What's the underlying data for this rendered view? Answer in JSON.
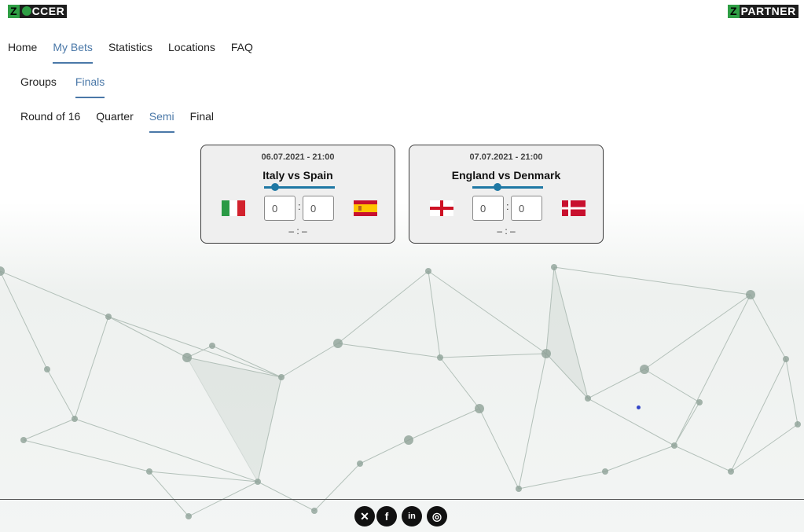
{
  "logos": {
    "left": {
      "z": "Z",
      "rest": "CCER"
    },
    "right": {
      "z": "Z",
      "rest": "PARTNER"
    }
  },
  "nav_main": [
    {
      "label": "Home",
      "active": false
    },
    {
      "label": "My Bets",
      "active": true
    },
    {
      "label": "Statistics",
      "active": false
    },
    {
      "label": "Locations",
      "active": false
    },
    {
      "label": "FAQ",
      "active": false
    }
  ],
  "nav_sub": [
    {
      "label": "Groups",
      "active": false
    },
    {
      "label": "Finals",
      "active": true
    }
  ],
  "nav_round": [
    {
      "label": "Round of 16",
      "active": false
    },
    {
      "label": "Quarter",
      "active": false
    },
    {
      "label": "Semi",
      "active": true
    },
    {
      "label": "Final",
      "active": false
    }
  ],
  "matches": [
    {
      "date": "06.07.2021 - 21:00",
      "teams": "Italy vs Spain",
      "home_flag": "italy-flag",
      "away_flag": "spain-flag",
      "home_score": "0",
      "away_score": "0",
      "separator": ":",
      "result": "– : –",
      "slider_fraction": 0.15
    },
    {
      "date": "07.07.2021 - 21:00",
      "teams": "England vs Denmark",
      "home_flag": "england-flag",
      "away_flag": "denmark-flag",
      "home_score": "0",
      "away_score": "0",
      "separator": ":",
      "result": "– : –",
      "slider_fraction": 0.35
    }
  ],
  "social": [
    {
      "name": "xing-icon",
      "glyph": "✕"
    },
    {
      "name": "facebook-icon",
      "glyph": "f"
    },
    {
      "name": "linkedin-icon",
      "glyph": "in"
    },
    {
      "name": "instagram-icon",
      "glyph": "◎"
    }
  ],
  "colors": {
    "accent": "#4a78a8",
    "slider": "#1f78a4",
    "brand_green": "#2e9e44"
  }
}
